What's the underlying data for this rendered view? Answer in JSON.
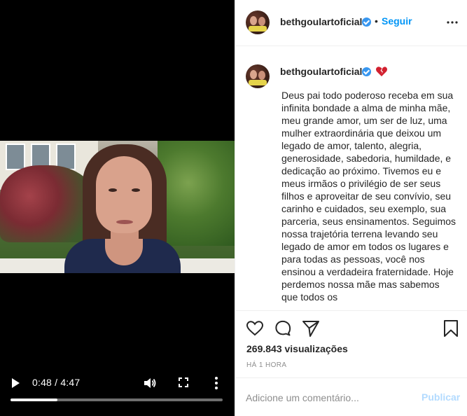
{
  "video": {
    "time_display": "0:48 / 4:47",
    "progress_fraction": 0.22
  },
  "header": {
    "username": "bethgoulartoficial",
    "separator": "•",
    "follow_label": "Seguir"
  },
  "caption": {
    "username": "bethgoulartoficial",
    "text": "Deus pai todo poderoso receba em sua infinita bondade a alma de minha mãe, meu grande amor, um ser de luz, uma mulher extraordinária que deixou um legado de amor, talento, alegria, generosidade, sabedoria, humildade, e dedicação ao próximo. Tivemos eu e meus irmãos o privilégio de ser seus filhos e aproveitar de seu convívio, seu carinho e cuidados, seu exemplo, sua parceria, seus ensinamentos. Seguimos nossa trajetória terrena levando seu legado de amor em todos os lugares e para todas as pessoas, você nos ensinou a verdadeira fraternidade. Hoje perdemos nossa mãe mas sabemos que todos os"
  },
  "stats": {
    "views": "269.843 visualizações",
    "time_ago": "HÁ 1 HORA"
  },
  "comment": {
    "placeholder": "Adicione um comentário...",
    "publish_label": "Publicar"
  },
  "colors": {
    "accent": "#0095f6",
    "verified": "#3897f0",
    "publish_disabled": "#b3dbff",
    "broken_heart": "#d2202f"
  },
  "icons": [
    "play-icon",
    "volume-icon",
    "fullscreen-icon",
    "more-vertical-icon",
    "more-horizontal-icon",
    "verified-icon",
    "broken-heart-icon",
    "like-icon",
    "comment-icon",
    "share-icon",
    "save-icon"
  ]
}
